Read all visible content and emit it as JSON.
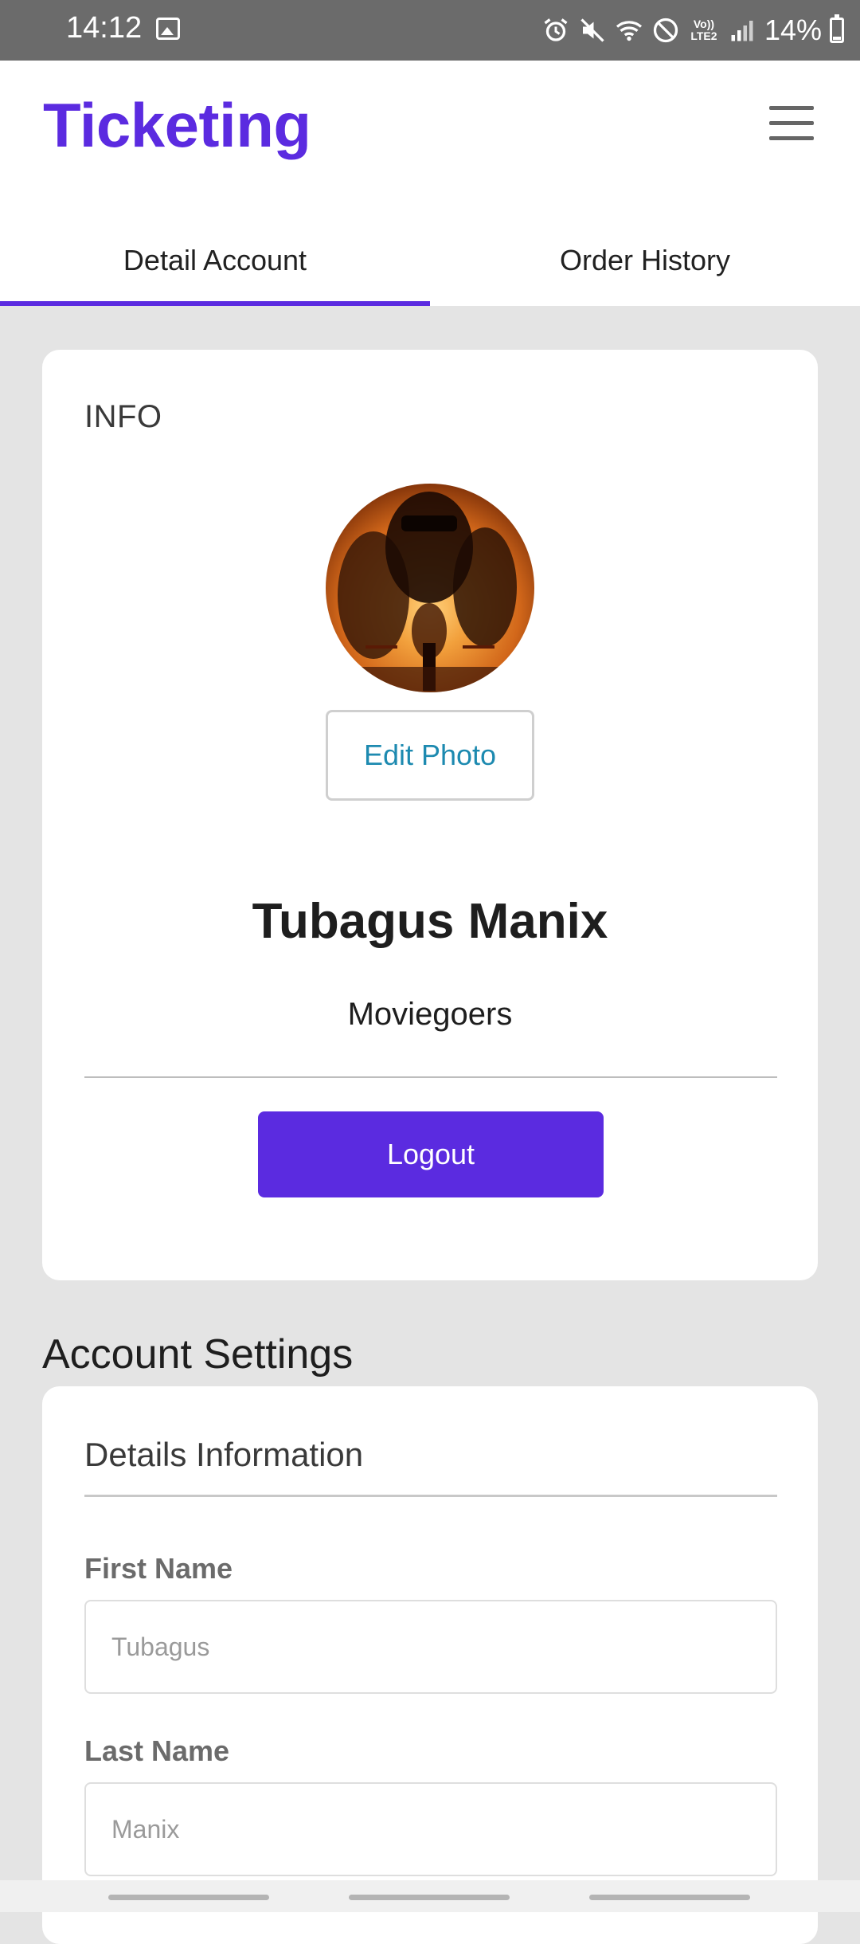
{
  "status_bar": {
    "time": "14:12",
    "network_label_top": "Vo))",
    "network_label_bottom": "LTE2",
    "battery_percent": "14%",
    "battery_level": 0.14,
    "icons": [
      "gallery-icon",
      "alarm-icon",
      "mute-icon",
      "wifi-icon",
      "block-icon",
      "signal-icon",
      "battery-icon"
    ]
  },
  "app": {
    "brand": "Ticketing",
    "brand_color": "#5b2be0",
    "menu_icon": "hamburger-menu-icon"
  },
  "tabs": [
    {
      "label": "Detail Account",
      "active": true
    },
    {
      "label": "Order History",
      "active": false
    }
  ],
  "info_card": {
    "title": "INFO",
    "avatar_alt": "profile photo",
    "edit_photo_label": "Edit Photo",
    "name": "Tubagus Manix",
    "role": "Moviegoers",
    "logout_label": "Logout"
  },
  "account_settings": {
    "heading": "Account Settings",
    "details_title": "Details Information",
    "fields": [
      {
        "label": "First Name",
        "placeholder": "Tubagus",
        "value": ""
      },
      {
        "label": "Last Name",
        "placeholder": "Manix",
        "value": ""
      }
    ]
  },
  "colors": {
    "accent": "#5b2be0",
    "link": "#1d8ab0",
    "background": "#e4e4e4"
  }
}
